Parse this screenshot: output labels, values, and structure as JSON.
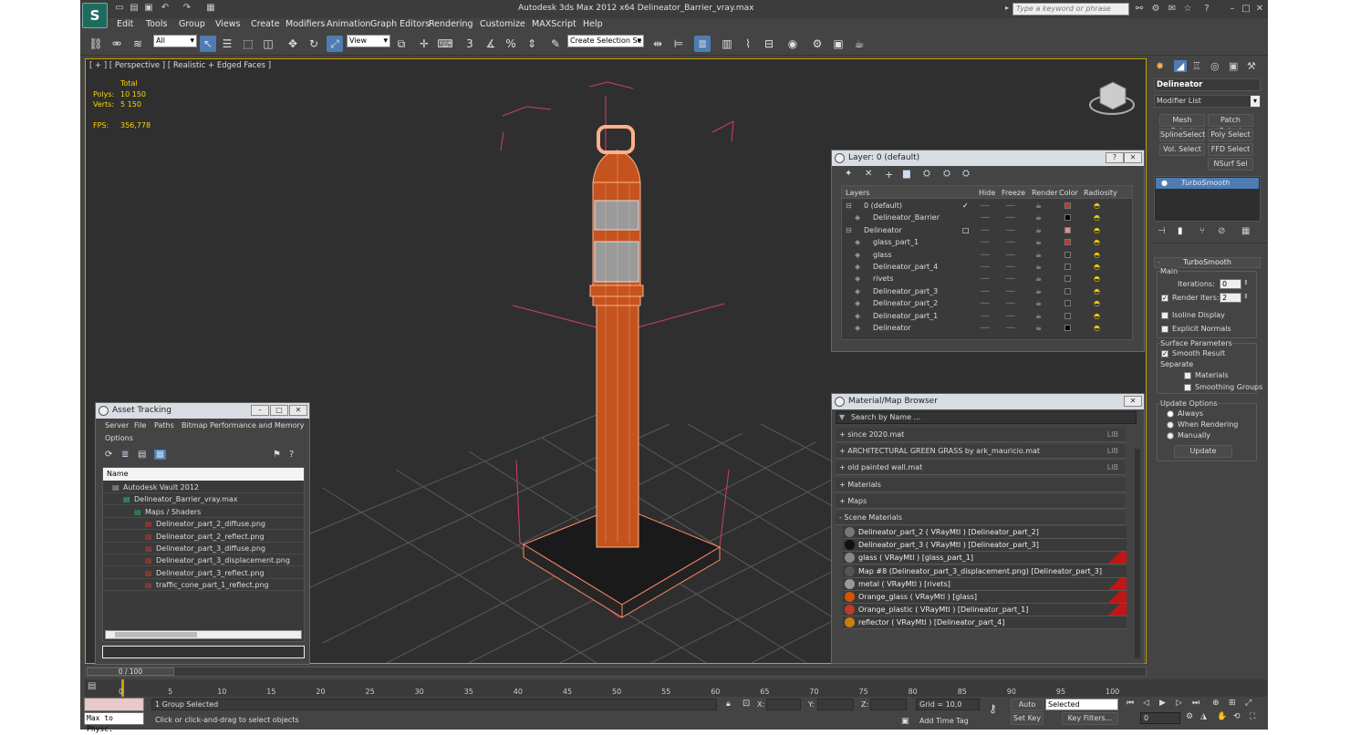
{
  "app": {
    "logo": "S",
    "title": "Autodesk 3ds Max  2012 x64      Delineator_Barrier_vray.max",
    "search_placeholder": "Type a keyword or phrase"
  },
  "menu": [
    "Edit",
    "Tools",
    "Group",
    "Views",
    "Create",
    "Modifiers",
    "Animation",
    "Graph Editors",
    "Rendering",
    "Customize",
    "MAXScript",
    "Help"
  ],
  "toolbar": {
    "filter": "All",
    "refcoord": "View",
    "selection_set": "Create Selection Se",
    "snap_num": "3",
    "pct": "%"
  },
  "viewport": {
    "label": "[ + ] [ Perspective ] [ Realistic + Edged Faces ]",
    "stats": {
      "total_label": "Total",
      "polys_label": "Polys:",
      "polys": "10 150",
      "verts_label": "Verts:",
      "verts": "5 150",
      "fps_label": "FPS:",
      "fps": "356,778"
    }
  },
  "layer_window": {
    "title": "Layer: 0 (default)",
    "columns": [
      "Layers",
      "Hide",
      "Freeze",
      "Render",
      "Color",
      "Radiosity"
    ],
    "rows": [
      {
        "name": "0 (default)",
        "level": 0,
        "color": "#c0392b"
      },
      {
        "name": "Delineator_Barrier",
        "level": 1,
        "color": "#000000"
      },
      {
        "name": "Delineator",
        "level": 0,
        "color": "#e88a8a"
      },
      {
        "name": "glass_part_1",
        "level": 1,
        "color": "#c0392b"
      },
      {
        "name": "glass",
        "level": 1,
        "color": "#333333"
      },
      {
        "name": "Delineator_part_4",
        "level": 1,
        "color": "#333333"
      },
      {
        "name": "rivets",
        "level": 1,
        "color": "#333333"
      },
      {
        "name": "Delineator_part_3",
        "level": 1,
        "color": "#333333"
      },
      {
        "name": "Delineator_part_2",
        "level": 1,
        "color": "#333333"
      },
      {
        "name": "Delineator_part_1",
        "level": 1,
        "color": "#333333"
      },
      {
        "name": "Delineator",
        "level": 1,
        "color": "#000000"
      }
    ]
  },
  "asset_window": {
    "title": "Asset Tracking",
    "menu": [
      "Server",
      "File",
      "Paths",
      "Bitmap Performance and Memory",
      "Options"
    ],
    "column": "Name",
    "rows": [
      {
        "name": "Autodesk Vault 2012",
        "indent": 1
      },
      {
        "name": "Delineator_Barrier_vray.max",
        "indent": 2
      },
      {
        "name": "Maps / Shaders",
        "indent": 3
      },
      {
        "name": "Delineator_part_2_diffuse.png",
        "indent": 4
      },
      {
        "name": "Delineator_part_2_reflect.png",
        "indent": 4
      },
      {
        "name": "Delineator_part_3_diffuse.png",
        "indent": 4
      },
      {
        "name": "Delineator_part_3_displacement.png",
        "indent": 4
      },
      {
        "name": "Delineator_part_3_reflect.png",
        "indent": 4
      },
      {
        "name": "traffic_cone_part_1_reflect.png",
        "indent": 4
      }
    ]
  },
  "material_browser": {
    "title": "Material/Map Browser",
    "search": "Search by Name ...",
    "groups": [
      {
        "label": "+ since 2020.mat",
        "lib": "LIB"
      },
      {
        "label": "+ ARCHITECTURAL GREEN GRASS by ark_mauricio.mat",
        "lib": "LIB"
      },
      {
        "label": "+ old painted wall.mat",
        "lib": "LIB"
      },
      {
        "label": "+ Materials",
        "lib": ""
      },
      {
        "label": "+ Maps",
        "lib": ""
      },
      {
        "label": "- Scene Materials",
        "lib": ""
      }
    ],
    "scene_materials": [
      {
        "label": "Delineator_part_2  ( VRayMtl )  [Delineator_part_2]",
        "icon": "#777777",
        "red": false
      },
      {
        "label": "Delineator_part_3  ( VRayMtl )  [Delineator_part_3]",
        "icon": "#111111",
        "red": false
      },
      {
        "label": "glass  ( VRayMtl )  [glass_part_1]",
        "icon": "#888888",
        "red": true
      },
      {
        "label": "Map #8 (Delineator_part_3_displacement.png) [Delineator_part_3]",
        "icon": "#555555",
        "red": false
      },
      {
        "label": "metal  ( VRayMtl )  [rivets]",
        "icon": "#999999",
        "red": true
      },
      {
        "label": "Orange_glass  ( VRayMtl )  [glass]",
        "icon": "#d35400",
        "red": true
      },
      {
        "label": "Orange_plastic  ( VRayMtl )  [Delineator_part_1]",
        "icon": "#c0392b",
        "red": true
      },
      {
        "label": "reflector  ( VRayMtl )  [Delineator_part_4]",
        "icon": "#c87f0a",
        "red": false
      }
    ]
  },
  "command_panel": {
    "object_name": "Delineator",
    "modifier_list": "Modifier List",
    "buttons": [
      "Mesh Select",
      "Patch Select",
      "SplineSelect",
      "Poly Select",
      "Vol. Select",
      "FFD Select",
      "NSurf Sel"
    ],
    "stack_item": "TurboSmooth",
    "rollout": "TurboSmooth",
    "main": "Main",
    "iterations_label": "Iterations:",
    "iterations": "0",
    "render_iters_label": "Render Iters:",
    "render_iters": "2",
    "isoline": "Isoline Display",
    "explicit": "Explicit Normals",
    "surface_params": "Surface Parameters",
    "smooth_result": "Smooth Result",
    "separate": "Separate",
    "materials": "Materials",
    "smoothing_groups": "Smoothing Groups",
    "update_options": "Update Options",
    "always": "Always",
    "when_rendering": "When Rendering",
    "manually": "Manually",
    "update": "Update"
  },
  "timeline": {
    "frame": "0 / 100",
    "ticks": [
      "0",
      "5",
      "10",
      "15",
      "20",
      "25",
      "30",
      "35",
      "40",
      "45",
      "50",
      "55",
      "60",
      "65",
      "70",
      "75",
      "80",
      "85",
      "90",
      "95",
      "100"
    ]
  },
  "status": {
    "script_hint": "Max to Physc.",
    "selection": "1 Group Selected",
    "prompt": "Click or click-and-drag to select objects",
    "x_label": "X:",
    "y_label": "Y:",
    "z_label": "Z:",
    "grid": "Grid = 10,0",
    "add_time_tag": "Add Time Tag",
    "auto_key": "Auto Key",
    "key_mode": "Selected",
    "set_key": "Set Key",
    "key_filters": "Key Filters...",
    "frame_value": "0"
  }
}
